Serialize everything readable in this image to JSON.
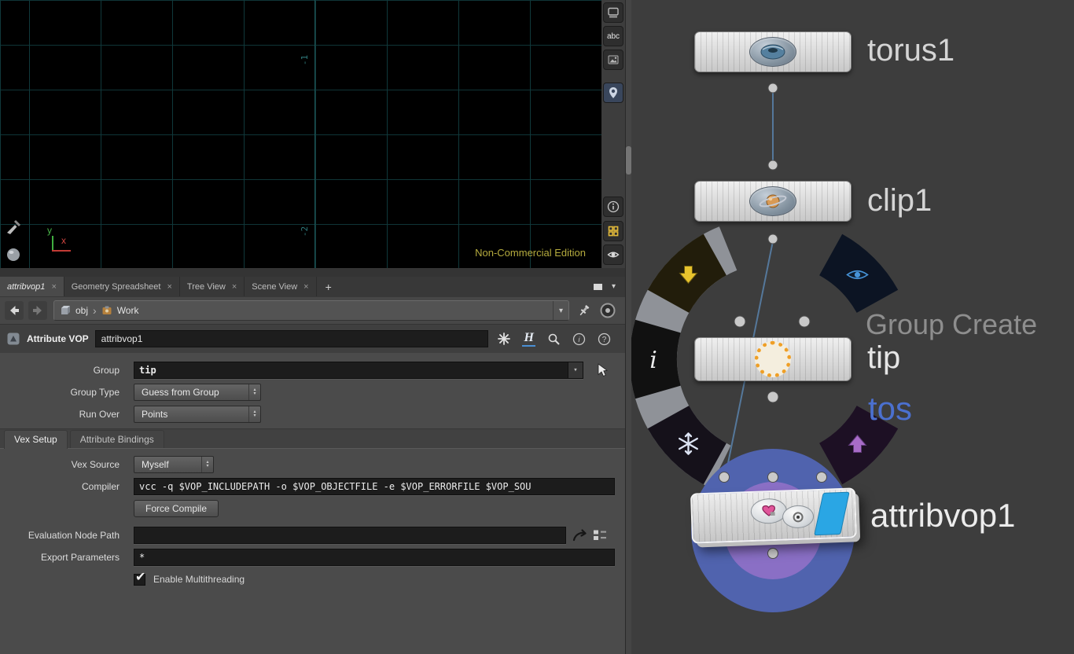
{
  "viewport": {
    "edition_label": "Non-Commercial Edition",
    "ticks": [
      "-1",
      "-2"
    ],
    "axis": {
      "x": "x",
      "y": "y"
    },
    "toolbar_abc": "abc"
  },
  "pane_tabs": {
    "items": [
      {
        "label": "attribvop1"
      },
      {
        "label": "Geometry Spreadsheet"
      },
      {
        "label": "Tree View"
      },
      {
        "label": "Scene View"
      }
    ],
    "close_glyph": "×",
    "add_glyph": "+",
    "menu_glyph": "▾"
  },
  "path_bar": {
    "root": "obj",
    "current": "Work",
    "separator": "›",
    "menu_glyph": "▾"
  },
  "node_header": {
    "type_label": "Attribute VOP",
    "name": "attribvop1",
    "houdini_glyph": "H",
    "info_glyph": "i",
    "help_glyph": "?"
  },
  "parameters": {
    "group": {
      "label": "Group",
      "value": "tip"
    },
    "group_type": {
      "label": "Group Type",
      "value": "Guess from Group"
    },
    "run_over": {
      "label": "Run Over",
      "value": "Points"
    },
    "tabs": [
      {
        "label": "Vex Setup"
      },
      {
        "label": "Attribute Bindings"
      }
    ],
    "vex_source": {
      "label": "Vex Source",
      "value": "Myself"
    },
    "compiler": {
      "label": "Compiler",
      "value": "vcc -q $VOP_INCLUDEPATH -o $VOP_OBJECTFILE -e $VOP_ERRORFILE $VOP_SOU"
    },
    "force_compile": "Force Compile",
    "evaluation_node_path": {
      "label": "Evaluation Node Path",
      "value": ""
    },
    "export_parameters": {
      "label": "Export Parameters",
      "value": "*"
    },
    "enable_multithreading": {
      "label": "Enable Multithreading",
      "check_glyph": "✔"
    },
    "menu_glyph": "▾",
    "spin_up": "▴",
    "spin_down": "▾"
  },
  "network": {
    "torus_label": "torus1",
    "clip_label": "clip1",
    "attribvop_label": "attribvop1",
    "radial_menu": {
      "heading": "Group Create",
      "selected": "tip",
      "background_text": "tos",
      "info_glyph": "i"
    }
  }
}
